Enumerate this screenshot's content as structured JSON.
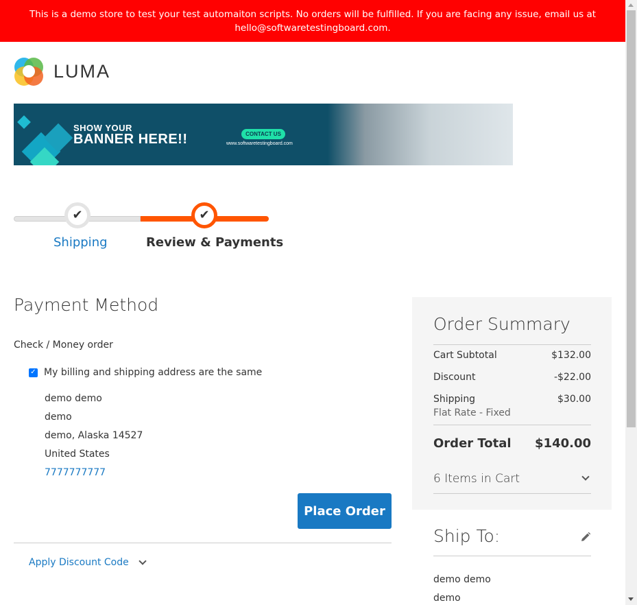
{
  "demo_notice": {
    "line1": "This is a demo store to test your test automaiton scripts. No orders will be fulfilled. If you are facing any issue, email us at",
    "line2": "hello@softwaretestingboard.com."
  },
  "logo": {
    "text": "LUMA"
  },
  "banner": {
    "line1": "SHOW YOUR",
    "line2": "BANNER HERE!!",
    "cta": "CONTACT US",
    "url": "www.softwaretestingboard.com"
  },
  "progress": {
    "steps": [
      {
        "label": "Shipping",
        "status": "complete"
      },
      {
        "label": "Review & Payments",
        "status": "active"
      }
    ]
  },
  "payment": {
    "title": "Payment Method",
    "method": "Check / Money order",
    "same_address_label": "My billing and shipping address are the same",
    "same_address_checked": true,
    "billing_address": [
      "demo demo",
      "demo",
      "demo, Alaska 14527",
      "United States"
    ],
    "phone": "7777777777",
    "place_order_label": "Place Order",
    "discount_label": "Apply Discount Code"
  },
  "summary": {
    "title": "Order Summary",
    "rows": [
      {
        "label": "Cart Subtotal",
        "value": "$132.00"
      },
      {
        "label": "Discount",
        "value": "-$22.00"
      },
      {
        "label": "Shipping",
        "value": "$30.00"
      }
    ],
    "shipping_method": "Flat Rate - Fixed",
    "total_label": "Order Total",
    "total_value": "$140.00",
    "items_in_cart": "6 Items in Cart"
  },
  "ship_to": {
    "title": "Ship To:",
    "address": [
      "demo demo",
      "demo"
    ]
  },
  "colors": {
    "demo_bar": "#ff0101",
    "accent_orange": "#ff5501",
    "link_blue": "#1979c3",
    "button_blue": "#1979c3"
  }
}
